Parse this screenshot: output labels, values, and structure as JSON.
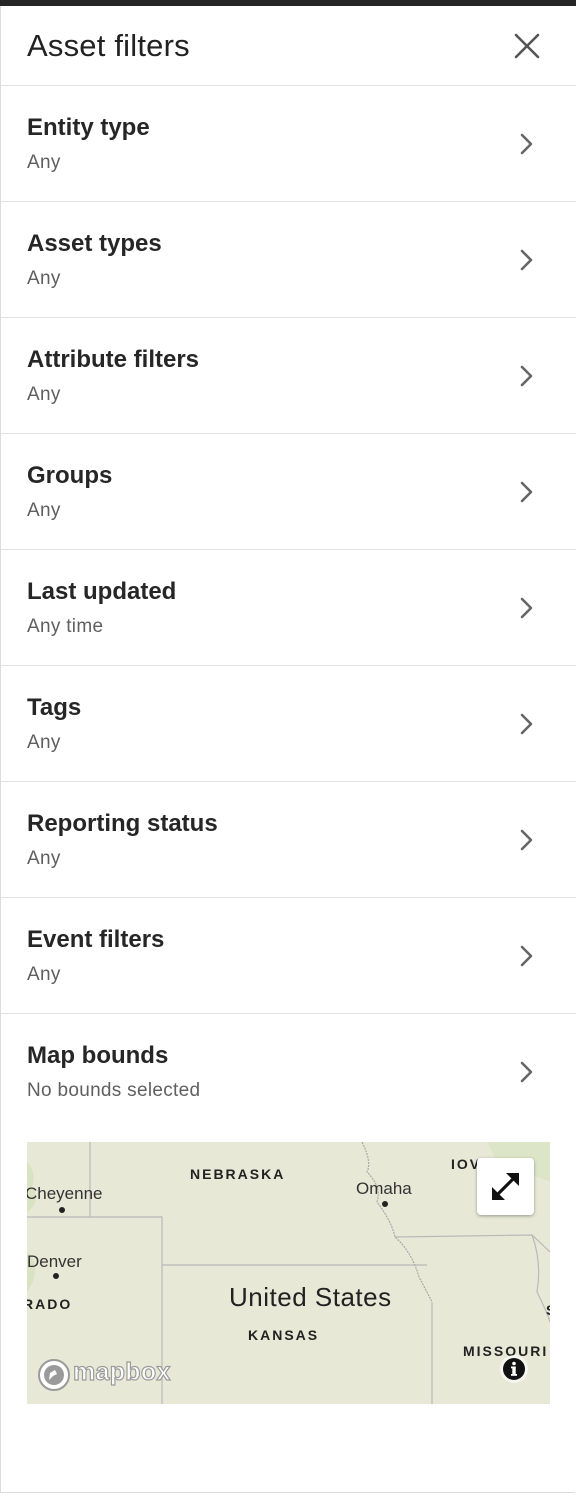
{
  "header": {
    "title": "Asset filters"
  },
  "filters": [
    {
      "label": "Entity type",
      "value": "Any"
    },
    {
      "label": "Asset types",
      "value": "Any"
    },
    {
      "label": "Attribute filters",
      "value": "Any"
    },
    {
      "label": "Groups",
      "value": "Any"
    },
    {
      "label": "Last updated",
      "value": "Any time"
    },
    {
      "label": "Tags",
      "value": "Any"
    },
    {
      "label": "Reporting status",
      "value": "Any"
    },
    {
      "label": "Event filters",
      "value": "Any"
    },
    {
      "label": "Map bounds",
      "value": "No bounds selected"
    }
  ],
  "map": {
    "labels": {
      "nebraska": "NEBRASKA",
      "iowa": "IOV",
      "cheyenne": "Cheyenne",
      "omaha": "Omaha",
      "denver": "Denver",
      "colorado": "RADO",
      "country": "United States",
      "kansas": "KANSAS",
      "missouri": "MISSOURI",
      "edge": "S"
    },
    "attribution_logo": "mapbox",
    "icons": [
      "expand-icon",
      "info-icon",
      "mapbox-logo"
    ]
  },
  "colors": {
    "map_background": "#e7e9d6",
    "border": "#e2e2e2",
    "top_bar": "#262626"
  }
}
